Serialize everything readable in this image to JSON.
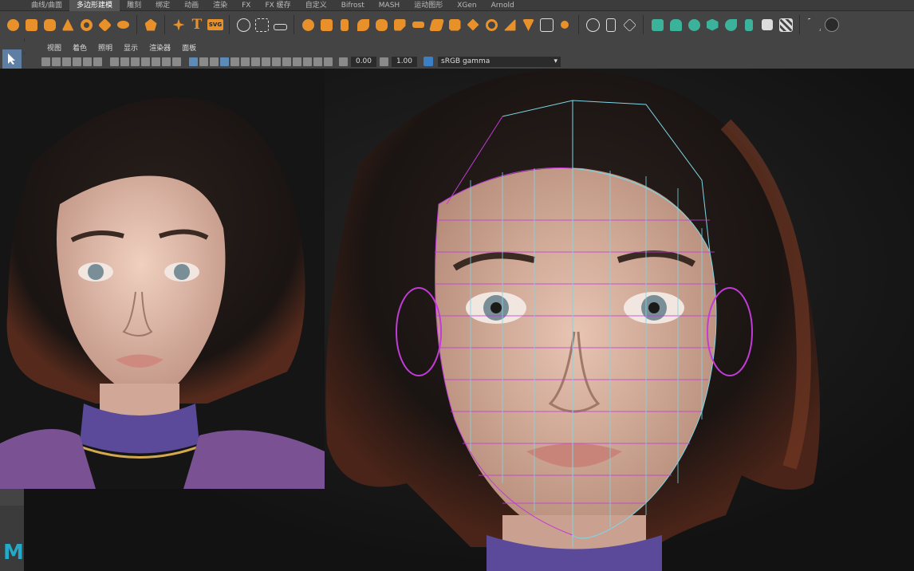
{
  "shelf": {
    "tabs": [
      {
        "label": "曲线/曲面",
        "active": false
      },
      {
        "label": "多边形建模",
        "active": true
      },
      {
        "label": "雕刻",
        "active": false
      },
      {
        "label": "绑定",
        "active": false
      },
      {
        "label": "动画",
        "active": false
      },
      {
        "label": "渲染",
        "active": false
      },
      {
        "label": "FX",
        "active": false
      },
      {
        "label": "FX 缓存",
        "active": false
      },
      {
        "label": "自定义",
        "active": false
      },
      {
        "label": "Bifrost",
        "active": false
      },
      {
        "label": "MASH",
        "active": false
      },
      {
        "label": "运动图形",
        "active": false
      },
      {
        "label": "XGen",
        "active": false
      },
      {
        "label": "Arnold",
        "active": false
      }
    ],
    "text_tool_glyph": "T",
    "svg_tool_label": "SVG"
  },
  "panel": {
    "menus": [
      "视图",
      "着色",
      "照明",
      "显示",
      "渲染器",
      "面板"
    ],
    "exposure_value": "0.00",
    "gamma_value": "1.00",
    "color_space": "sRGB gamma"
  },
  "left_toolbar": {
    "logo_letter": "M"
  },
  "icons": {
    "select_tool": "arrow-select-icon",
    "maya_logo": "maya-logo-icon"
  },
  "colors": {
    "accent_orange": "#e8912a",
    "accent_teal": "#3bb39a",
    "wireframe_cyan": "#7ed6e6",
    "wireframe_magenta": "#c13bd6",
    "selection_blue": "#5d7fa3"
  }
}
